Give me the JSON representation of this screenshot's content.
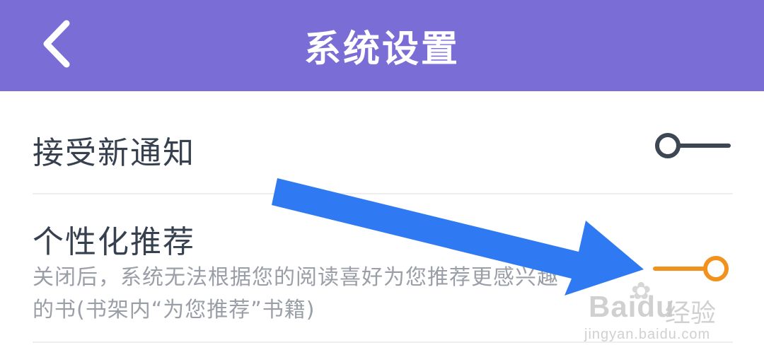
{
  "header": {
    "title": "系统设置",
    "back_icon": "chevron-left-icon"
  },
  "settings": [
    {
      "label": "接受新通知",
      "toggle_state": "off",
      "toggle_color": "#3d4653"
    },
    {
      "label": "个性化推荐",
      "description": "关闭后，系统无法根据您的阅读喜好为您推荐更感兴趣的书(书架内“为您推荐”书籍)",
      "toggle_state": "on",
      "toggle_color": "#f2911b"
    }
  ],
  "colors": {
    "header_bg": "#7b6dd6",
    "annotation_arrow": "#2f7af2"
  },
  "watermark": {
    "brand": "Bai",
    "brand_suffix": "du",
    "cn": "经验",
    "url": "jingyan.baidu.com"
  }
}
